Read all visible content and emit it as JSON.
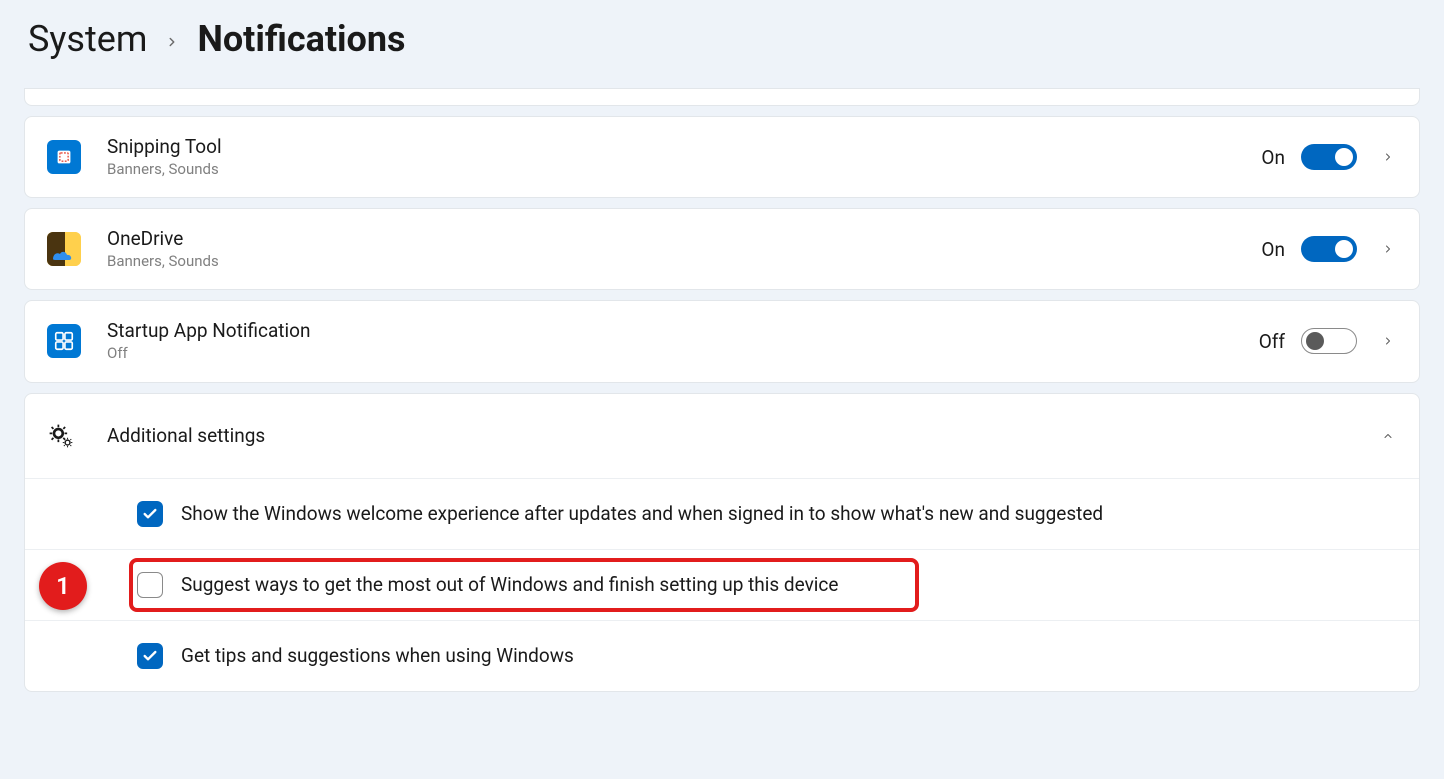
{
  "breadcrumb": {
    "parent": "System",
    "current": "Notifications"
  },
  "apps": [
    {
      "name": "Snipping Tool",
      "sub": "Banners, Sounds",
      "status": "On",
      "toggle": "on"
    },
    {
      "name": "OneDrive",
      "sub": "Banners, Sounds",
      "status": "On",
      "toggle": "on"
    },
    {
      "name": "Startup App Notification",
      "sub": "Off",
      "status": "Off",
      "toggle": "off"
    }
  ],
  "additional": {
    "title": "Additional settings",
    "options": [
      {
        "label": "Show the Windows welcome experience after updates and when signed in to show what's new and suggested",
        "checked": true
      },
      {
        "label": "Suggest ways to get the most out of Windows and finish setting up this device",
        "checked": false
      },
      {
        "label": "Get tips and suggestions when using Windows",
        "checked": true
      }
    ]
  },
  "annotation": {
    "badge": "1"
  }
}
